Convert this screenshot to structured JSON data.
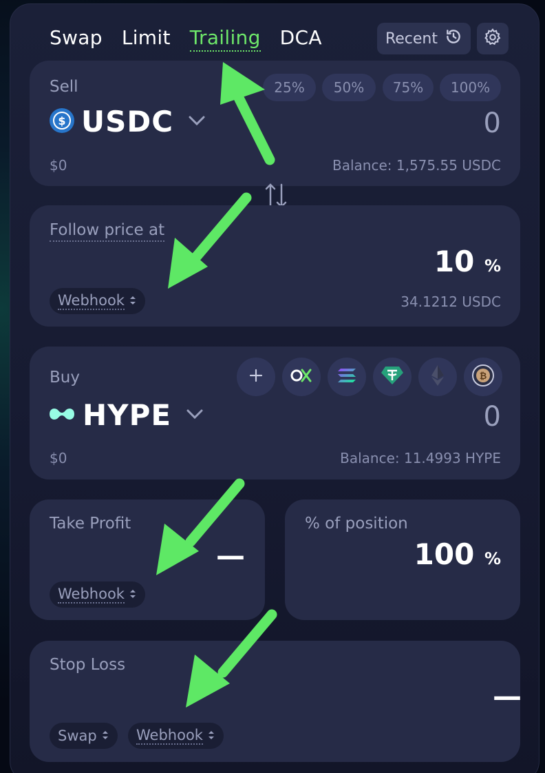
{
  "tabs": [
    {
      "label": "Swap",
      "active": false
    },
    {
      "label": "Limit",
      "active": false
    },
    {
      "label": "Trailing",
      "active": true
    },
    {
      "label": "DCA",
      "active": false
    }
  ],
  "header": {
    "recent_label": "Recent",
    "recent_icon": "history-icon",
    "settings_icon": "gear-icon"
  },
  "sell": {
    "label": "Sell",
    "percent_buttons": [
      "25%",
      "50%",
      "75%",
      "100%"
    ],
    "token": "USDC",
    "amount": "0",
    "usd_value": "$0",
    "balance": "Balance: 1,575.55 USDC"
  },
  "follow": {
    "label": "Follow price at",
    "value": "10",
    "unit": "%",
    "mode": "Webhook",
    "price": "34.1212 USDC"
  },
  "buy": {
    "label": "Buy",
    "quick_tokens": [
      "plus-icon",
      "ox-icon",
      "solana-icon",
      "tether-icon",
      "ethereum-icon",
      "bitcoin-icon"
    ],
    "token": "HYPE",
    "amount": "0",
    "usd_value": "$0",
    "balance": "Balance: 11.4993 HYPE"
  },
  "take_profit": {
    "label": "Take Profit",
    "value": "—",
    "mode": "Webhook"
  },
  "position": {
    "label": "% of position",
    "value": "100",
    "unit": "%"
  },
  "stop_loss": {
    "label": "Stop Loss",
    "value": "—",
    "mode1": "Swap",
    "mode2": "Webhook"
  },
  "colors": {
    "accent_green": "#6ee86a",
    "usdc_blue": "#2775ca",
    "hype_teal": "#97fce4"
  }
}
